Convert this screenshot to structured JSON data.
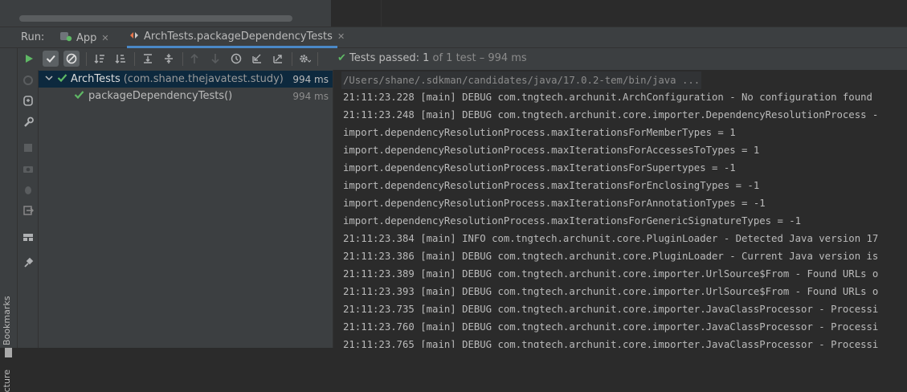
{
  "run_bar": {
    "label": "Run:",
    "tabs": [
      {
        "label": "App",
        "close": "✕"
      },
      {
        "label": "ArchTests.packageDependencyTests",
        "close": "✕"
      }
    ]
  },
  "status": {
    "check": "✔",
    "passed_label": "Tests passed:",
    "passed_count": "1",
    "of_text": "of 1 test",
    "duration": "– 994 ms"
  },
  "tree": {
    "items": [
      {
        "name": "ArchTests",
        "package": "(com.shane.thejavatest.study)",
        "time": "994 ms"
      },
      {
        "name": "packageDependencyTests()",
        "time": "994 ms"
      }
    ]
  },
  "side": {
    "bookmarks": "Bookmarks",
    "structure": "cture"
  },
  "console": {
    "command": "/Users/shane/.sdkman/candidates/java/17.0.2-tem/bin/java ...",
    "lines": [
      "21:11:23.228 [main] DEBUG com.tngtech.archunit.ArchConfiguration - No configuration found",
      "21:11:23.248 [main] DEBUG com.tngtech.archunit.core.importer.DependencyResolutionProcess -",
      "import.dependencyResolutionProcess.maxIterationsForMemberTypes = 1",
      "import.dependencyResolutionProcess.maxIterationsForAccessesToTypes = 1",
      "import.dependencyResolutionProcess.maxIterationsForSupertypes = -1",
      "import.dependencyResolutionProcess.maxIterationsForEnclosingTypes = -1",
      "import.dependencyResolutionProcess.maxIterationsForAnnotationTypes = -1",
      "import.dependencyResolutionProcess.maxIterationsForGenericSignatureTypes = -1",
      "21:11:23.384 [main] INFO com.tngtech.archunit.core.PluginLoader - Detected Java version 17",
      "21:11:23.386 [main] DEBUG com.tngtech.archunit.core.PluginLoader - Current Java version is",
      "21:11:23.389 [main] DEBUG com.tngtech.archunit.core.importer.UrlSource$From - Found URLs o",
      "21:11:23.393 [main] DEBUG com.tngtech.archunit.core.importer.UrlSource$From - Found URLs o",
      "21:11:23.735 [main] DEBUG com.tngtech.archunit.core.importer.JavaClassProcessor - Processi",
      "21:11:23.760 [main] DEBUG com.tngtech.archunit.core.importer.JavaClassProcessor - Processi",
      "21:11:23.765 [main] DEBUG com.tngtech.archunit.core.importer.JavaClassProcessor - Processi"
    ]
  },
  "colors": {
    "panel_bg": "#3c3f41",
    "console_bg": "#2b2b2b",
    "selection": "#0d293e",
    "pass_green": "#5fb865",
    "tab_underline": "#4a88c7"
  }
}
